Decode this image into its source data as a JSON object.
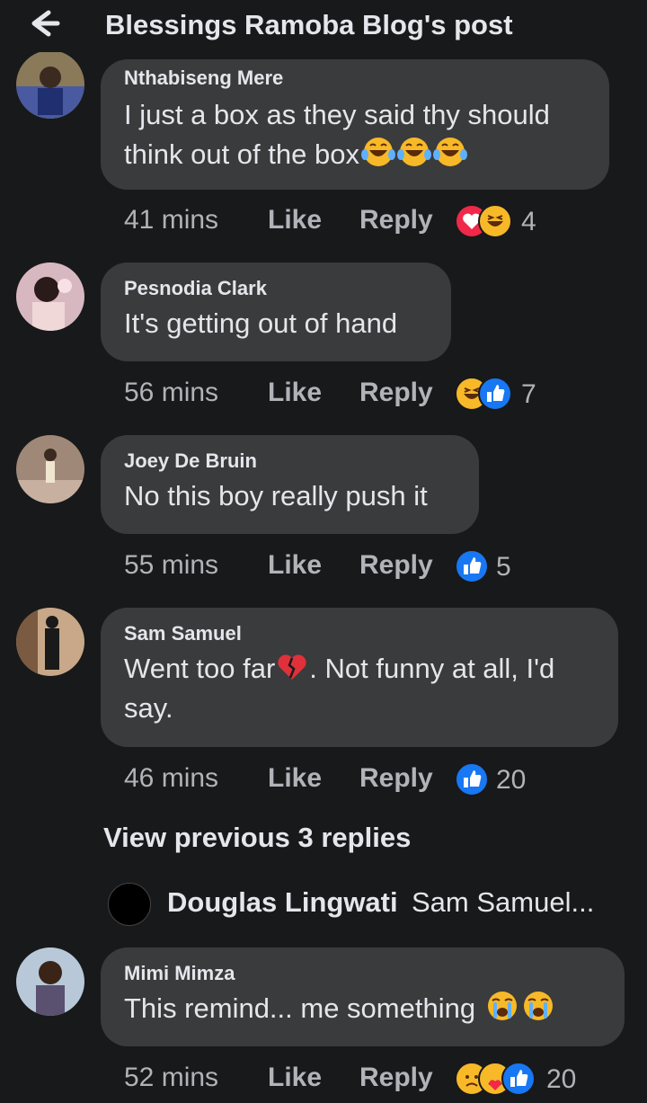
{
  "header": {
    "title": "Blessings Ramoba Blog's post"
  },
  "comments": [
    {
      "author": "Nthabiseng Mere",
      "text": "I just a box as they said thy should think out of the box",
      "time": "41 mins",
      "like": "Like",
      "reply": "Reply",
      "reaction_count": "4",
      "reactions": [
        "love",
        "haha"
      ],
      "text_emojis": [
        "laughing-tears",
        "laughing-tears",
        "laughing-tears"
      ]
    },
    {
      "author": "Pesnodia Clark",
      "text": "It's getting out of hand",
      "time": "56 mins",
      "like": "Like",
      "reply": "Reply",
      "reaction_count": "7",
      "reactions": [
        "haha",
        "like"
      ]
    },
    {
      "author": "Joey De Bruin",
      "text": "No this boy really push it",
      "time": "55 mins",
      "like": "Like",
      "reply": "Reply",
      "reaction_count": "5",
      "reactions": [
        "like"
      ]
    },
    {
      "author": "Sam Samuel",
      "text_a": "Went too far",
      "text_b": ". Not funny at all, I'd say.",
      "time": "46 mins",
      "like": "Like",
      "reply": "Reply",
      "reaction_count": "20",
      "reactions": [
        "like"
      ],
      "text_emojis": [
        "broken-heart"
      ]
    },
    {
      "author": "Mimi Mimza",
      "text": "This remind... me something",
      "time": "52 mins",
      "like": "Like",
      "reply": "Reply",
      "reaction_count": "20",
      "reactions": [
        "sad",
        "care",
        "like"
      ],
      "text_emojis": [
        "crying",
        "crying"
      ]
    }
  ],
  "view_previous": "View previous 3 replies",
  "reply_preview": {
    "author": "Douglas Lingwati",
    "text": "Sam Samuel..."
  },
  "colors": {
    "background": "#18191a",
    "bubble": "#3a3b3c",
    "meta": "#b0b3b8",
    "like_blue": "#1877f2",
    "love_red": "#f02849",
    "haha_yellow": "#f7b928"
  }
}
